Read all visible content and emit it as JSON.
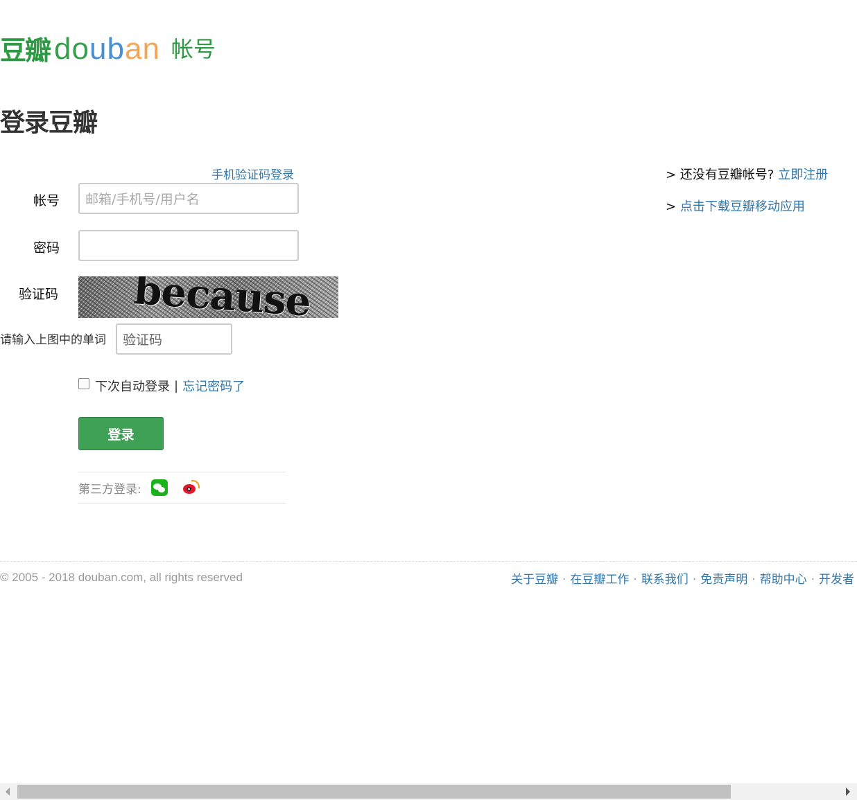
{
  "header": {
    "logo_cn": "豆瓣",
    "logo_en": [
      "d",
      "o",
      "u",
      "b",
      "a",
      "n"
    ],
    "logo_suffix": "帐号"
  },
  "page_title": "登录豆瓣",
  "form": {
    "phone_login_link": "手机验证码登录",
    "account_label": "帐号",
    "account_placeholder": "邮箱/手机号/用户名",
    "password_label": "密码",
    "captcha_label": "验证码",
    "captcha_word": "because",
    "captcha_prompt": "请输入上图中的单词",
    "captcha_placeholder": "验证码",
    "remember_label": "下次自动登录",
    "remember_checked": false,
    "separator": "|",
    "forgot_link": "忘记密码了",
    "submit_label": "登录",
    "third_party_label": "第三方登录:",
    "third_party_icons": [
      "wechat-icon",
      "weibo-icon"
    ]
  },
  "aside": {
    "register_prefix": "> 还没有豆瓣帐号?",
    "register_link": "立即注册",
    "app_prefix": ">",
    "app_link": "点击下载豆瓣移动应用"
  },
  "footer": {
    "copyright": "© 2005 - 2018 douban.com, all rights reserved",
    "links": [
      "关于豆瓣",
      "在豆瓣工作",
      "联系我们",
      "免责声明",
      "帮助中心",
      "开发者"
    ],
    "link_separator": "·"
  },
  "colors": {
    "brand_green": "#2f9a44",
    "link_blue": "#37a",
    "button_green": "#3fa156"
  }
}
